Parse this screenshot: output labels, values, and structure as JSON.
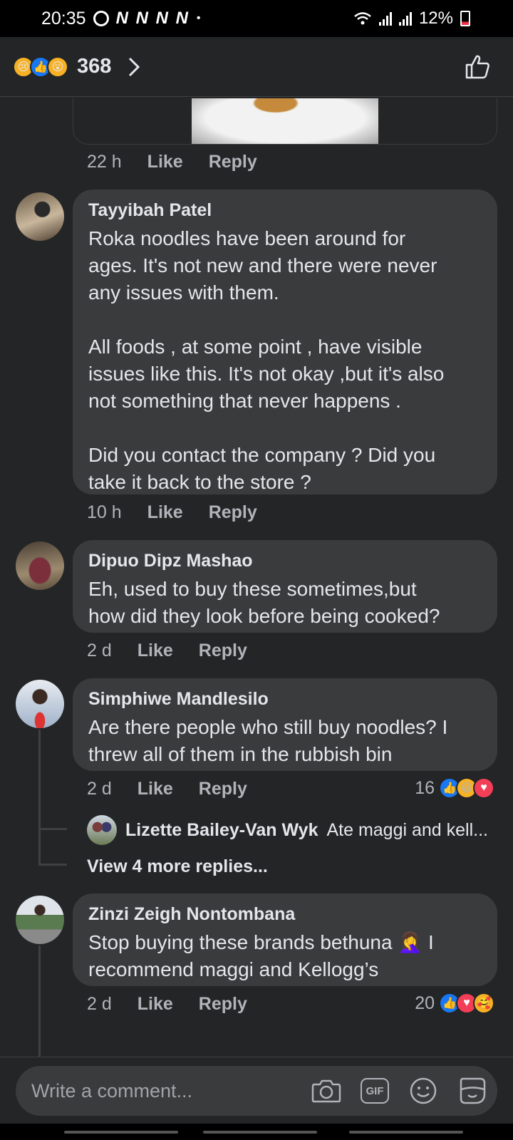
{
  "status_bar": {
    "time": "20:35",
    "notif": "N N N N",
    "dot": "•",
    "battery": "12%"
  },
  "header": {
    "reaction_count": "368",
    "reaction_icons": [
      "sad",
      "like",
      "wow"
    ]
  },
  "previous_comment": {
    "time": "22 h",
    "like_label": "Like",
    "reply_label": "Reply"
  },
  "comments": [
    {
      "author": "Tayyibah Patel",
      "text": "Roka noodles have been around for\nages.  It's not new and there were never\nany issues with them.\n\n  All foods , at some point , have visible\nissues like this. It's not okay  ,but it's also\nnot something that never happens .\n\nDid you contact the company ? Did you\ntake it back to the store ?",
      "time": "10 h",
      "like_label": "Like",
      "reply_label": "Reply"
    },
    {
      "author": "Dipuo Dipz Mashao",
      "text": "Eh, used to buy these sometimes,but\nhow did they look before being cooked?",
      "time": "2 d",
      "like_label": "Like",
      "reply_label": "Reply"
    },
    {
      "author": "Simphiwe Mandlesilo",
      "text": "Are there people who still buy noodles? I\nthrew all of them in the rubbish bin",
      "time": "2 d",
      "like_label": "Like",
      "reply_label": "Reply",
      "reaction_count": "16",
      "reaction_icons": [
        "like",
        "haha",
        "love"
      ],
      "reply_preview": {
        "author": "Lizette Bailey-Van Wyk",
        "snippet": "Ate maggi and kell..."
      },
      "view_more": "View 4 more replies..."
    },
    {
      "author": "Zinzi Zeigh Nontombana",
      "text": "Stop buying these brands bethuna 🤦‍♀️ I\nrecommend maggi and Kellogg’s",
      "time": "2 d",
      "like_label": "Like",
      "reply_label": "Reply",
      "reaction_count": "20",
      "reaction_icons": [
        "like",
        "love",
        "care"
      ]
    }
  ],
  "composer": {
    "placeholder": "Write a comment...",
    "gif_label": "GIF"
  }
}
